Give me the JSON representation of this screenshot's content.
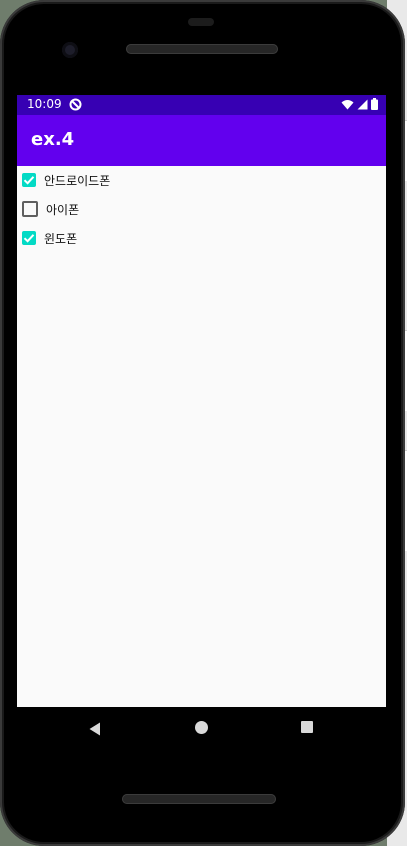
{
  "status_bar": {
    "time": "10:09",
    "icons": [
      "app-notification-icon",
      "wifi-icon",
      "signal-icon",
      "battery-icon"
    ],
    "background": "#3700b3"
  },
  "app_bar": {
    "title": "ex.4",
    "background": "#6200ee"
  },
  "checkboxes": [
    {
      "label": "안드로이드폰",
      "checked": true
    },
    {
      "label": "아이폰",
      "checked": false
    },
    {
      "label": "윈도폰",
      "checked": true
    }
  ],
  "colors": {
    "accent": "#03dac5",
    "content_background": "#fafafa"
  },
  "nav_bar": {
    "buttons": [
      "back-icon",
      "home-icon",
      "recents-icon"
    ]
  }
}
